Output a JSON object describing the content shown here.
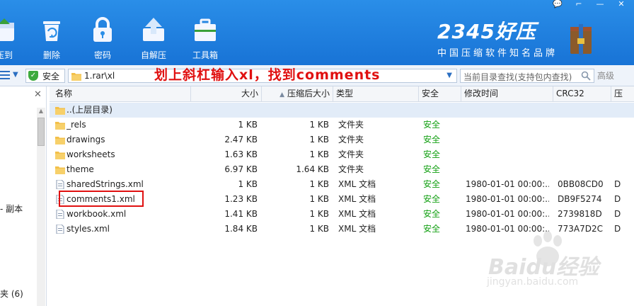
{
  "window_controls": [
    "💬",
    "⌐",
    "—",
    "✕"
  ],
  "toolbar": {
    "buttons": [
      {
        "label": "压到",
        "icon": "compress-icon"
      },
      {
        "label": "删除",
        "icon": "recycle-bin-icon"
      },
      {
        "label": "密码",
        "icon": "lock-icon"
      },
      {
        "label": "自解压",
        "icon": "self-extract-icon"
      },
      {
        "label": "工具箱",
        "icon": "toolbox-icon"
      }
    ]
  },
  "brand": {
    "name": "2345好压",
    "slogan": "中国压缩软件知名品牌"
  },
  "address_bar": {
    "safe_label": "安全",
    "path": "1.rar\\xl",
    "annotation": "划上斜杠输入xl，找到comments",
    "search_placeholder": "当前目录查找(支持包内查找)",
    "advanced_label": "高级"
  },
  "left_panel": {
    "item1": "- 副本",
    "item2": "夹 (6)"
  },
  "table": {
    "columns": {
      "name": "名称",
      "size": "大小",
      "packed": "压缩后大小",
      "type": "类型",
      "safety": "安全",
      "modified": "修改时间",
      "crc": "CRC32",
      "extra": "压"
    },
    "parent_row": "..(上层目录)",
    "rows": [
      {
        "name": "_rels",
        "size": "1 KB",
        "packed": "1 KB",
        "type": "文件夹",
        "safety": "安全",
        "modified": "",
        "crc": "",
        "extra": "",
        "kind": "folder"
      },
      {
        "name": "drawings",
        "size": "2.47 KB",
        "packed": "1 KB",
        "type": "文件夹",
        "safety": "安全",
        "modified": "",
        "crc": "",
        "extra": "",
        "kind": "folder"
      },
      {
        "name": "worksheets",
        "size": "1.63 KB",
        "packed": "1 KB",
        "type": "文件夹",
        "safety": "安全",
        "modified": "",
        "crc": "",
        "extra": "",
        "kind": "folder"
      },
      {
        "name": "theme",
        "size": "6.97 KB",
        "packed": "1.64 KB",
        "type": "文件夹",
        "safety": "安全",
        "modified": "",
        "crc": "",
        "extra": "",
        "kind": "folder"
      },
      {
        "name": "sharedStrings.xml",
        "size": "1 KB",
        "packed": "1 KB",
        "type": "XML 文档",
        "safety": "安全",
        "modified": "1980-01-01 00:00:...",
        "crc": "0BB08CD0",
        "extra": "D",
        "kind": "file"
      },
      {
        "name": "comments1.xml",
        "size": "1.23 KB",
        "packed": "1 KB",
        "type": "XML 文档",
        "safety": "安全",
        "modified": "1980-01-01 00:00:...",
        "crc": "DB9F5274",
        "extra": "D",
        "kind": "file"
      },
      {
        "name": "workbook.xml",
        "size": "1.41 KB",
        "packed": "1 KB",
        "type": "XML 文档",
        "safety": "安全",
        "modified": "1980-01-01 00:00:...",
        "crc": "2739818D",
        "extra": "D",
        "kind": "file"
      },
      {
        "name": "styles.xml",
        "size": "1.84 KB",
        "packed": "1 KB",
        "type": "XML 文档",
        "safety": "安全",
        "modified": "1980-01-01 00:00:...",
        "crc": "773A7D2C",
        "extra": "D",
        "kind": "file"
      }
    ]
  },
  "watermark": {
    "line1": "Baidu经验",
    "line2": "jingyan.baidu.com"
  },
  "colors": {
    "toolbar_blue": "#1f80e0",
    "safe_green": "#12a012",
    "annotation_red": "#e01010",
    "parent_row": "#e2ecf8"
  }
}
